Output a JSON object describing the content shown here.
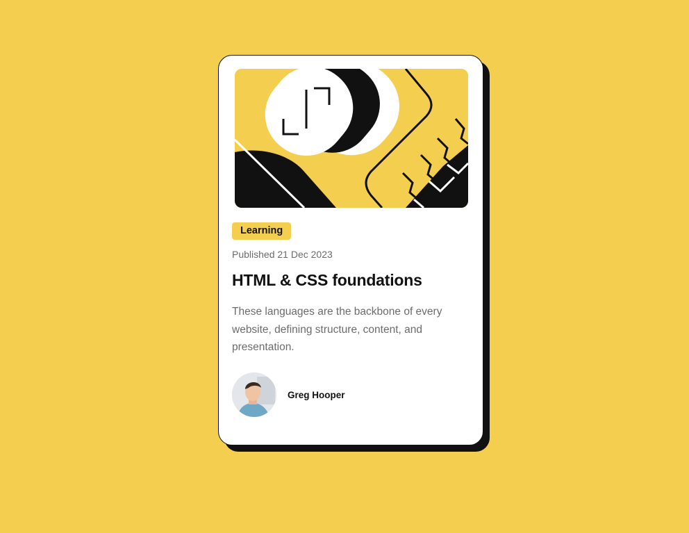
{
  "card": {
    "image_alt": "illustration-article",
    "tag": "Learning",
    "published": "Published 21 Dec 2023",
    "title": "HTML & CSS foundations",
    "description": "These languages are the backbone of every website, defining structure, content, and presentation.",
    "author": {
      "name": "Greg Hooper",
      "avatar_icon": "avatar-photo"
    }
  },
  "colors": {
    "background": "#f4ce4e",
    "card": "#ffffff",
    "ink": "#111111",
    "muted": "#6b6b6b",
    "tag_bg": "#f4ce4e"
  }
}
